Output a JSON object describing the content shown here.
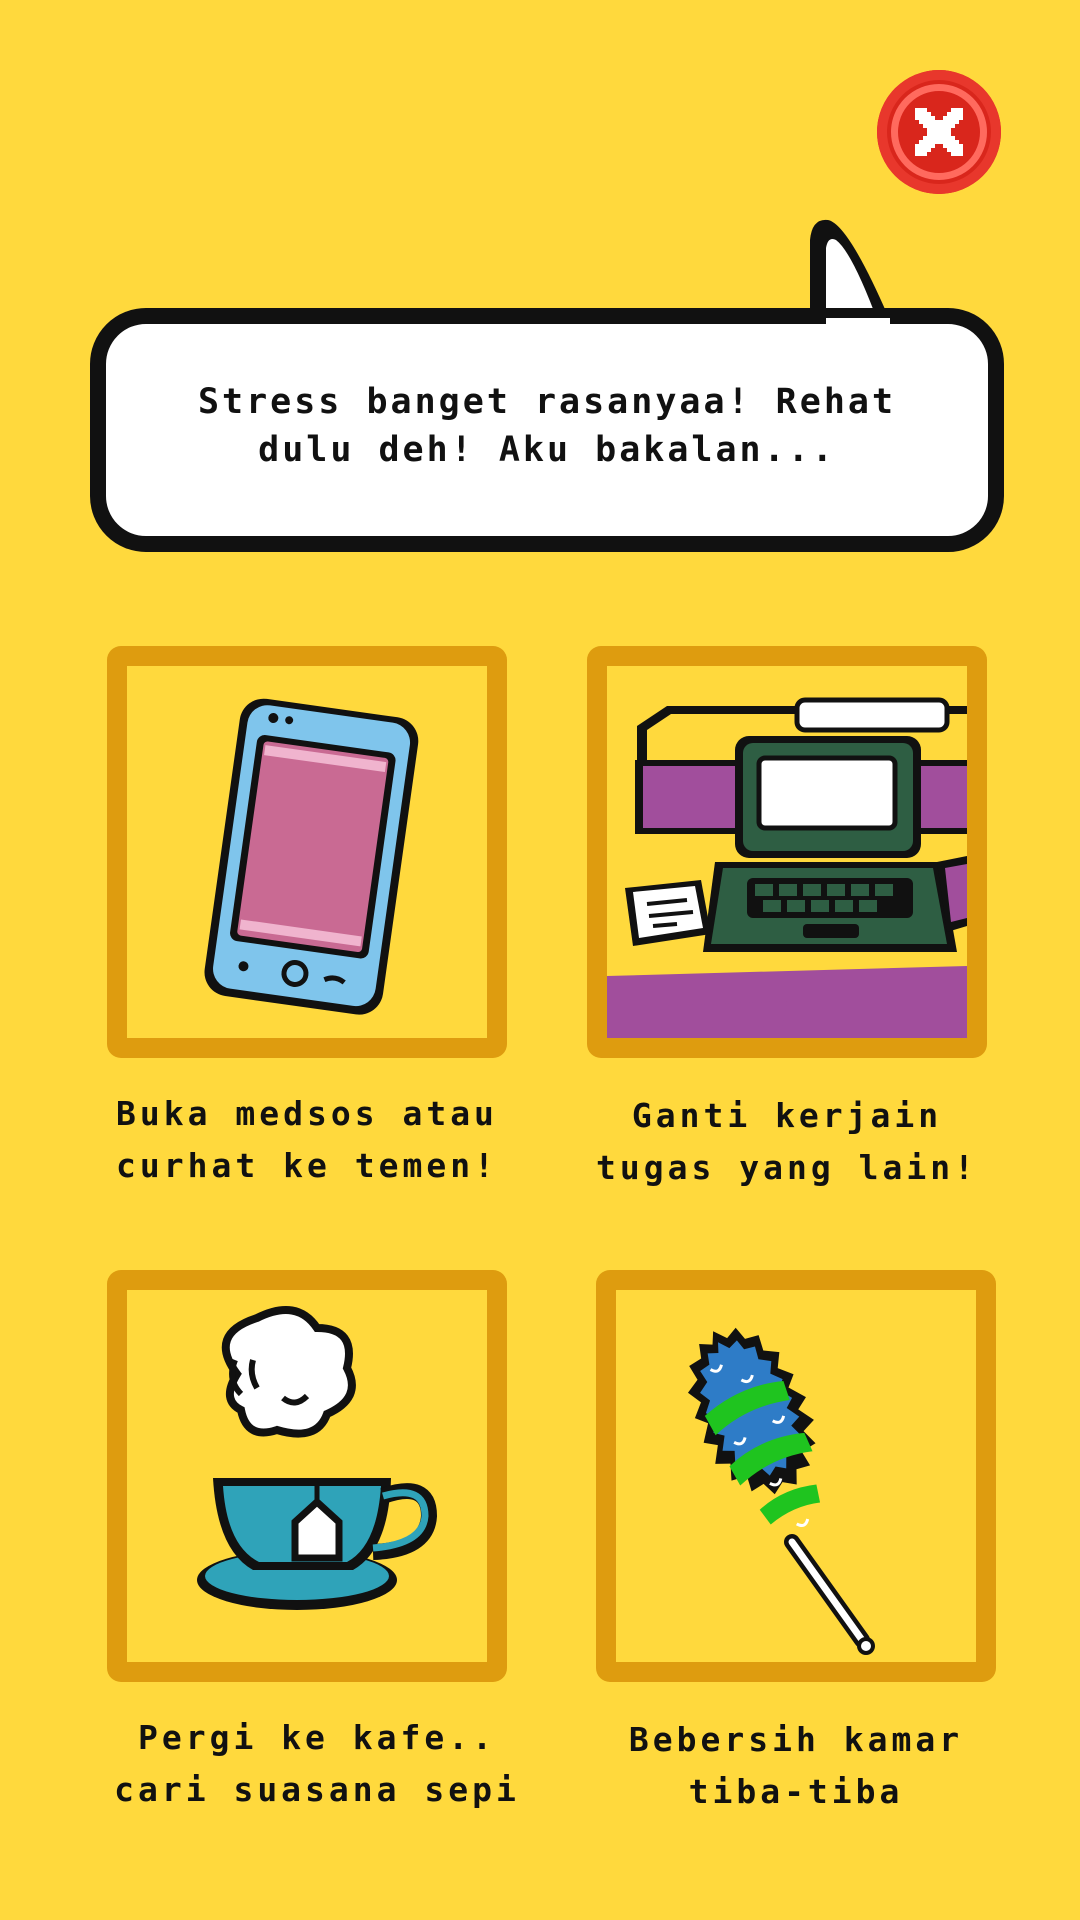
{
  "close_button": {
    "icon": "close-icon"
  },
  "speech_bubble": {
    "text": "Stress banget rasanyaa! Rehat\ndulu deh! Aku bakalan..."
  },
  "options": [
    {
      "caption": "Buka medsos atau\ncurhat ke temen!",
      "icon": "smartphone-icon"
    },
    {
      "caption": "Ganti kerjain\ntugas yang lain!",
      "icon": "laptop-desk-icon"
    },
    {
      "caption": "Pergi ke kafe..\ncari suasana sepi",
      "icon": "tea-cup-icon"
    },
    {
      "caption": "Bebersih kamar\ntiba-tiba",
      "icon": "feather-duster-icon"
    }
  ],
  "colors": {
    "background": "#FFD93D",
    "card_frame": "#DE9C0F",
    "close_button": "#D9261C"
  }
}
